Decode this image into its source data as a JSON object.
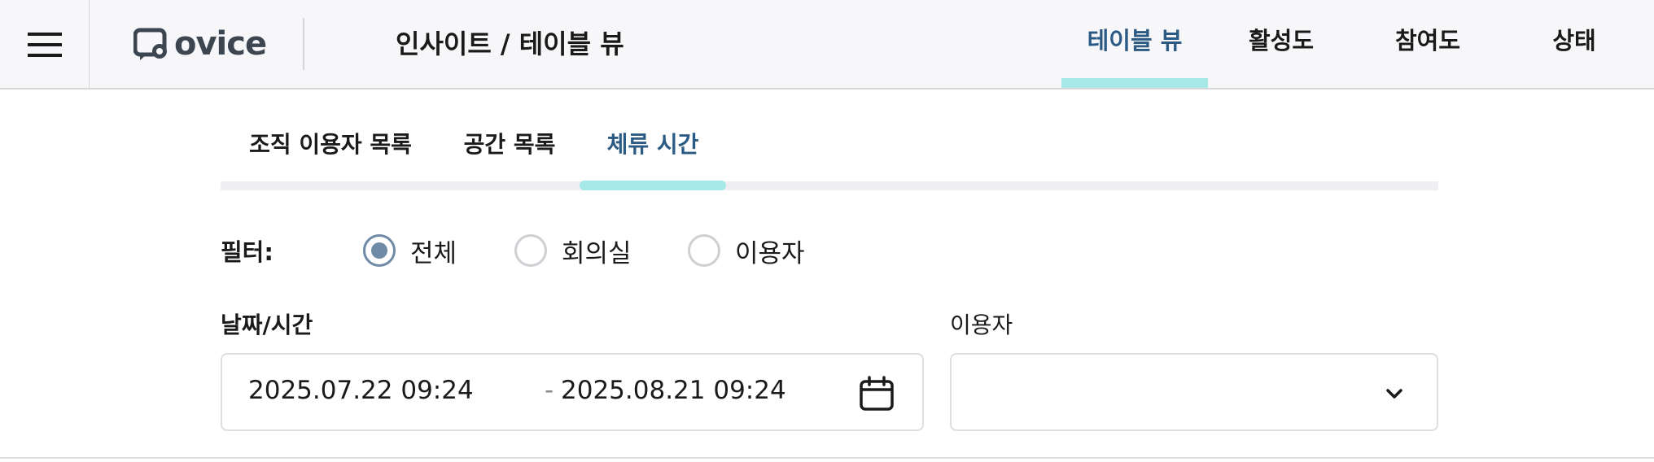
{
  "header": {
    "logo_text": "ovice",
    "breadcrumb": "인사이트 / 테이블 뷰",
    "tabs": [
      {
        "label": "테이블 뷰",
        "active": true
      },
      {
        "label": "활성도",
        "active": false
      },
      {
        "label": "참여도",
        "active": false
      },
      {
        "label": "상태",
        "active": false
      }
    ]
  },
  "subtabs": [
    {
      "label": "조직 이용자 목록",
      "active": false
    },
    {
      "label": "공간 목록",
      "active": false
    },
    {
      "label": "체류 시간",
      "active": true
    }
  ],
  "filter": {
    "label": "필터:",
    "options": [
      {
        "label": "전체",
        "checked": true
      },
      {
        "label": "회의실",
        "checked": false
      },
      {
        "label": "이용자",
        "checked": false
      }
    ]
  },
  "date_range": {
    "label": "날짜/시간",
    "start": "2025.07.22 09:24",
    "separator": "-",
    "end": "2025.08.21 09:24"
  },
  "user_select": {
    "label": "이용자",
    "value": ""
  },
  "colors": {
    "accent_text": "#2b5b84",
    "tab_indicator": "#a6e8e8",
    "radio_checked": "#6f8aa6",
    "topbar_bg": "#f7f7f9"
  }
}
